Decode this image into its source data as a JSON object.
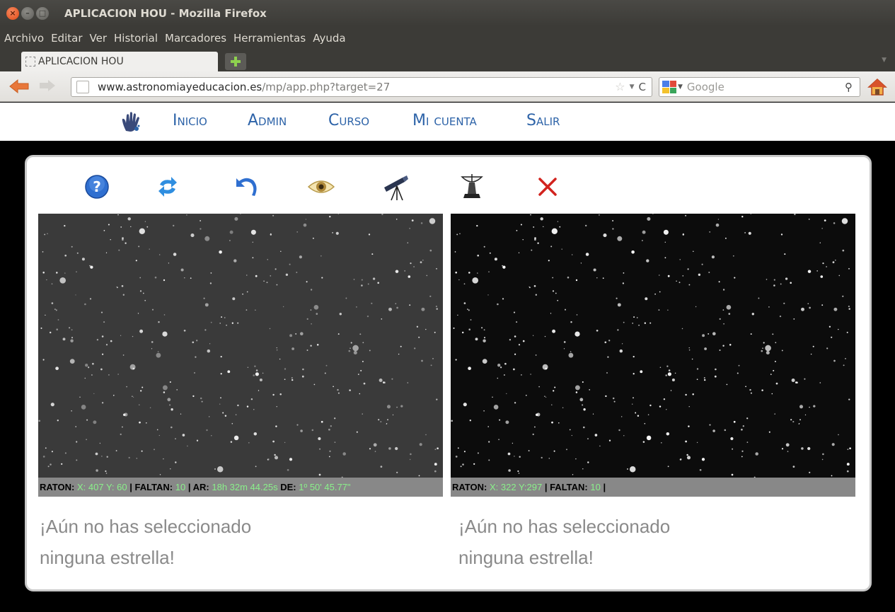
{
  "window": {
    "title": "APLICACION HOU - Mozilla Firefox"
  },
  "menubar": {
    "items": [
      "Archivo",
      "Editar",
      "Ver",
      "Historial",
      "Marcadores",
      "Herramientas",
      "Ayuda"
    ]
  },
  "tabs": [
    {
      "label": "APLICACION HOU"
    }
  ],
  "urlbar": {
    "domain": "www.astronomiayeducacion.es",
    "path": "/mp/app.php?target=27"
  },
  "searchbar": {
    "placeholder": "Google"
  },
  "site_nav": {
    "links": [
      "Inicio",
      "Admin",
      "Curso",
      "Mi cuenta",
      "Salir"
    ]
  },
  "toolbar": {
    "icons": [
      "help-icon",
      "refresh-icon",
      "undo-icon",
      "eye-icon",
      "telescope-icon",
      "satellite-dish-icon",
      "close-icon"
    ]
  },
  "left_panel": {
    "status": {
      "raton_label": "RATON:",
      "xy": "X: 407 Y: 60",
      "faltan_label": "| FALTAN:",
      "faltan_value": "10",
      "ar_label": "| AR:",
      "ar_value": "18h 32m 44.25s",
      "de_label": "DE:",
      "de_value": "1º 50' 45.77\""
    },
    "message_line1": "¡Aún no has seleccionado",
    "message_line2": "ninguna estrella!"
  },
  "right_panel": {
    "status": {
      "raton_label": "RATON:",
      "xy": "X: 322 Y:297",
      "faltan_label": "| FALTAN:",
      "faltan_value": "10",
      "end": "|"
    },
    "message_line1": "¡Aún no has seleccionado",
    "message_line2": "ninguna estrella!"
  },
  "colors": {
    "link_blue": "#2d63a8",
    "status_value_green": "#8af08a",
    "firefox_chrome_dark": "#3c3b37"
  }
}
